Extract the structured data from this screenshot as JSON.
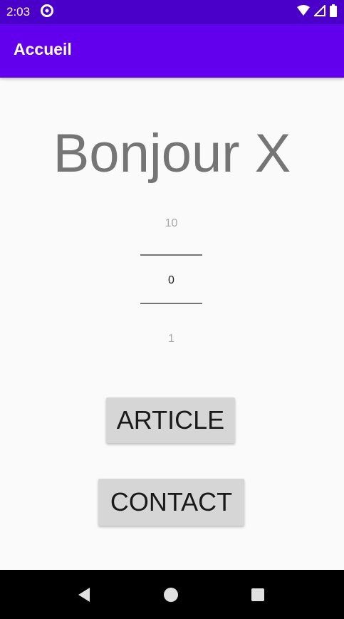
{
  "status_bar": {
    "time": "2:03",
    "icons": [
      "vpn-circle-icon",
      "wifi-icon",
      "signal-icon",
      "battery-icon"
    ]
  },
  "app_bar": {
    "title": "Accueil"
  },
  "main": {
    "greeting": "Bonjour X",
    "number_picker": {
      "previous": "10",
      "current": "0",
      "next": "1"
    },
    "buttons": {
      "article": "ARTICLE",
      "contact": "CONTACT"
    }
  },
  "nav_bar": {
    "icons": [
      "back-icon",
      "home-icon",
      "recents-icon"
    ]
  },
  "colors": {
    "status_bar": "#4a00c8",
    "app_bar": "#6200ee",
    "background": "#fafafa",
    "button": "#d6d6d6"
  }
}
